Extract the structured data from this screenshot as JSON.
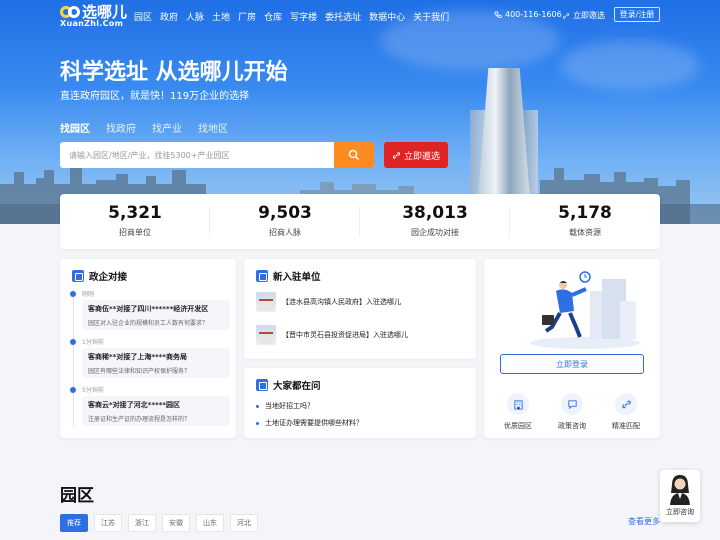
{
  "nav": {
    "logo_cn": "选哪儿",
    "logo_en": "XuanZhi.Com",
    "items": [
      "园区",
      "政府",
      "人脉",
      "土地",
      "厂房",
      "仓库",
      "写字楼",
      "委托选址",
      "数据中心",
      "关于我们"
    ],
    "phone": "400-116-1606",
    "contact": "立即邀选",
    "login": "登录/注册"
  },
  "hero": {
    "title": "科学选址 从选哪儿开始",
    "subtitle": "直连政府园区，就是快！119万企业的选择",
    "tabs": [
      "找园区",
      "找政府",
      "找产业",
      "找地区"
    ],
    "active_tab": "找园区",
    "search_placeholder": "请输入园区/地区/产业，找挂5300+产业园区",
    "cta": "立即邀选"
  },
  "stats": [
    {
      "value": "5,321",
      "label": "招商单位"
    },
    {
      "value": "9,503",
      "label": "招商人脉"
    },
    {
      "value": "38,013",
      "label": "园企成功对接"
    },
    {
      "value": "5,178",
      "label": "载体资源"
    }
  ],
  "dock": {
    "title": "政企对接",
    "items": [
      {
        "time": "刚刚",
        "title": "客商伍**对接了四川******经济开发区",
        "question": "园区对入驻企业的规模和员工人数有何要求？"
      },
      {
        "time": "1分钟前",
        "title": "客商稀**对接了上海****商务局",
        "question": "园区有哪些法律和知识产权保护服务？"
      },
      {
        "time": "5分钟前",
        "title": "客商云*对接了河北*****园区",
        "question": "注册证和生产证的办理流程是怎样的？"
      }
    ]
  },
  "newcomers": {
    "title": "新入驻单位",
    "items": [
      "【涟水县高沟镇人民政府】入驻选哪儿",
      "【晋中市灵石县投资促进局】入驻选哪儿"
    ]
  },
  "questions": {
    "title": "大家都在问",
    "items": [
      "当地好招工吗？",
      "土地证办理需要提供哪些材料？"
    ]
  },
  "login_card": {
    "button": "立即登录",
    "features": [
      {
        "icon": "building-icon",
        "label": "优质园区"
      },
      {
        "icon": "chat-icon",
        "label": "政策咨询"
      },
      {
        "icon": "link-icon",
        "label": "精准匹配"
      }
    ]
  },
  "park_section": {
    "title": "园区",
    "chips": [
      "推荐",
      "江苏",
      "浙江",
      "安徽",
      "山东",
      "河北"
    ],
    "active_chip": "推荐",
    "more": "查看更多"
  },
  "float_consult": {
    "label": "立即咨询"
  },
  "colors": {
    "primary": "#2f6fe3",
    "orange": "#ff8a1f",
    "red": "#e02424"
  }
}
